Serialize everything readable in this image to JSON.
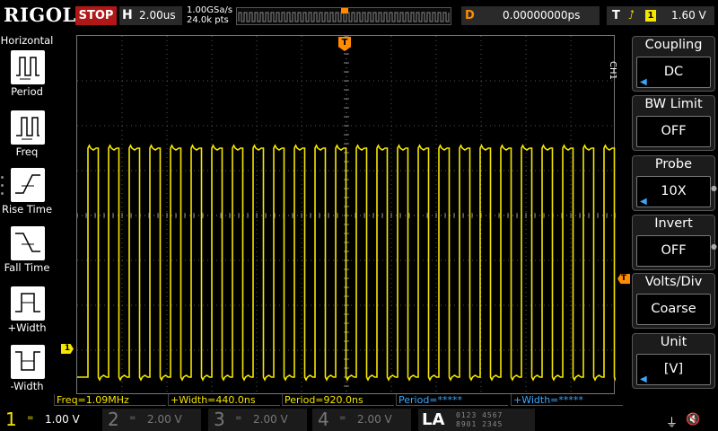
{
  "header": {
    "brand": "RIGOL",
    "run_state": "STOP",
    "horizontal": {
      "label": "H",
      "timebase": "2.00us"
    },
    "sample_rate": "1.00GSa/s",
    "memory_depth": "24.0k pts",
    "delay": {
      "label": "D",
      "value": "0.00000000ps"
    },
    "trigger": {
      "label": "T",
      "edge": "rising-edge-icon",
      "source": "1",
      "level": "1.60 V"
    }
  },
  "left_menu": {
    "title": "Horizontal",
    "items": [
      {
        "label": "Period",
        "icon": "period-icon"
      },
      {
        "label": "Freq",
        "icon": "freq-icon"
      },
      {
        "label": "Rise Time",
        "icon": "rise-time-icon"
      },
      {
        "label": "Fall Time",
        "icon": "fall-time-icon"
      },
      {
        "label": "+Width",
        "icon": "pos-width-icon"
      },
      {
        "label": "-Width",
        "icon": "neg-width-icon"
      }
    ]
  },
  "right_menu": {
    "channel_label": "CH1",
    "items": [
      {
        "title": "Coupling",
        "value": "DC",
        "selectable": true
      },
      {
        "title": "BW Limit",
        "value": "OFF",
        "selectable": false
      },
      {
        "title": "Probe",
        "value": "10X",
        "selectable": true
      },
      {
        "title": "Invert",
        "value": "OFF",
        "selectable": false
      },
      {
        "title": "Volts/Div",
        "value": "Coarse",
        "selectable": false
      },
      {
        "title": "Unit",
        "value": "[V]",
        "selectable": true
      }
    ]
  },
  "markers": {
    "trigger_position": "T",
    "channel1": "1",
    "trigger_level": "T"
  },
  "measurements": [
    {
      "text": "Freq=1.09MHz",
      "color": "#f4e600"
    },
    {
      "text": "+Width=440.0ns",
      "color": "#f4e600"
    },
    {
      "text": "Period=920.0ns",
      "color": "#f4e600"
    },
    {
      "text": "Period=*****",
      "color": "#3aa7ff"
    },
    {
      "text": "+Width=*****",
      "color": "#3aa7ff"
    }
  ],
  "channels": [
    {
      "number": "1",
      "coupling": "=",
      "scale": "1.00 V",
      "active": true,
      "color": "#f4e600"
    },
    {
      "number": "2",
      "coupling": "=",
      "scale": "2.00 V",
      "active": false
    },
    {
      "number": "3",
      "coupling": "=",
      "scale": "2.00 V",
      "active": false
    },
    {
      "number": "4",
      "coupling": "=",
      "scale": "2.00 V",
      "active": false
    }
  ],
  "logic_analyzer": {
    "label": "LA",
    "bits_row1": "0123 4567",
    "bits_row2": "8901 2345"
  },
  "status_icons": [
    "usb-icon",
    "speaker-mute-icon"
  ],
  "waveform": {
    "period_divs": 0.46,
    "high_level_divs": 1.5,
    "low_level_divs": -3.6,
    "horizontal_divisions": 12,
    "vertical_divisions": 8,
    "color": "#f4e600"
  },
  "colors": {
    "channel1": "#f4e600",
    "trigger": "#ff8c00",
    "stop": "#b01818",
    "ref_measure": "#3aa7ff"
  }
}
